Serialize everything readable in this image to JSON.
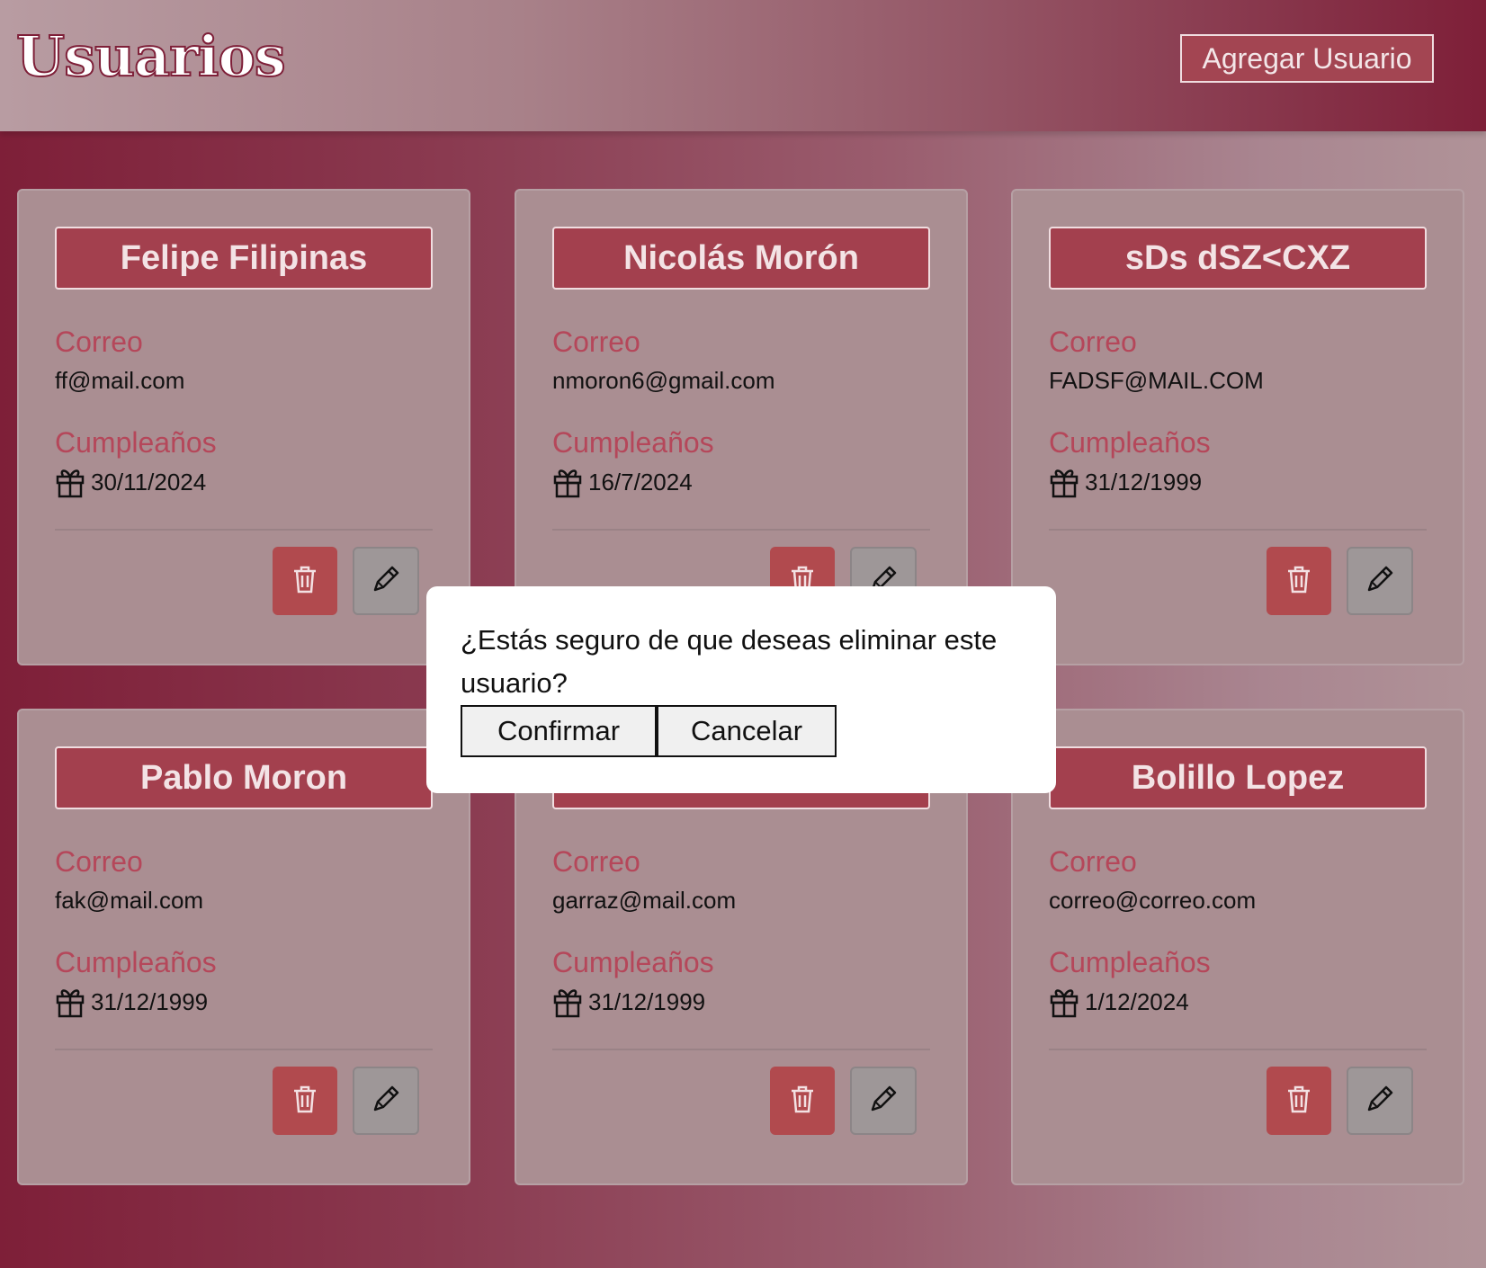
{
  "header": {
    "title": "Usuarios",
    "add_button_label": "Agregar Usuario"
  },
  "field_labels": {
    "email": "Correo",
    "birthday": "Cumpleaños"
  },
  "users": [
    {
      "name": "Felipe Filipinas",
      "email": "ff@mail.com",
      "birthday": "30/11/2024"
    },
    {
      "name": "Nicolás Morón",
      "email": "nmoron6@gmail.com",
      "birthday": "16/7/2024"
    },
    {
      "name": "sDs dSZ<CXZ",
      "email": "FADSF@MAIL.COM",
      "birthday": "31/12/1999"
    },
    {
      "name": "Pablo Moron",
      "email": "fak@mail.com",
      "birthday": "31/12/1999"
    },
    {
      "name": "",
      "email": "garraz@mail.com",
      "birthday": "31/12/1999"
    },
    {
      "name": "Bolillo Lopez",
      "email": "correo@correo.com",
      "birthday": "1/12/2024"
    }
  ],
  "icons": {
    "delete": "trash-icon",
    "edit": "pencil-icon",
    "birthday": "gift-icon"
  },
  "dialog": {
    "message": "¿Estás seguro de que deseas eliminar este usuario?",
    "confirm_label": "Confirmar",
    "cancel_label": "Cancelar"
  },
  "colors": {
    "accent": "#a3404e",
    "label": "#b5475a",
    "delete": "#b14a4e"
  }
}
